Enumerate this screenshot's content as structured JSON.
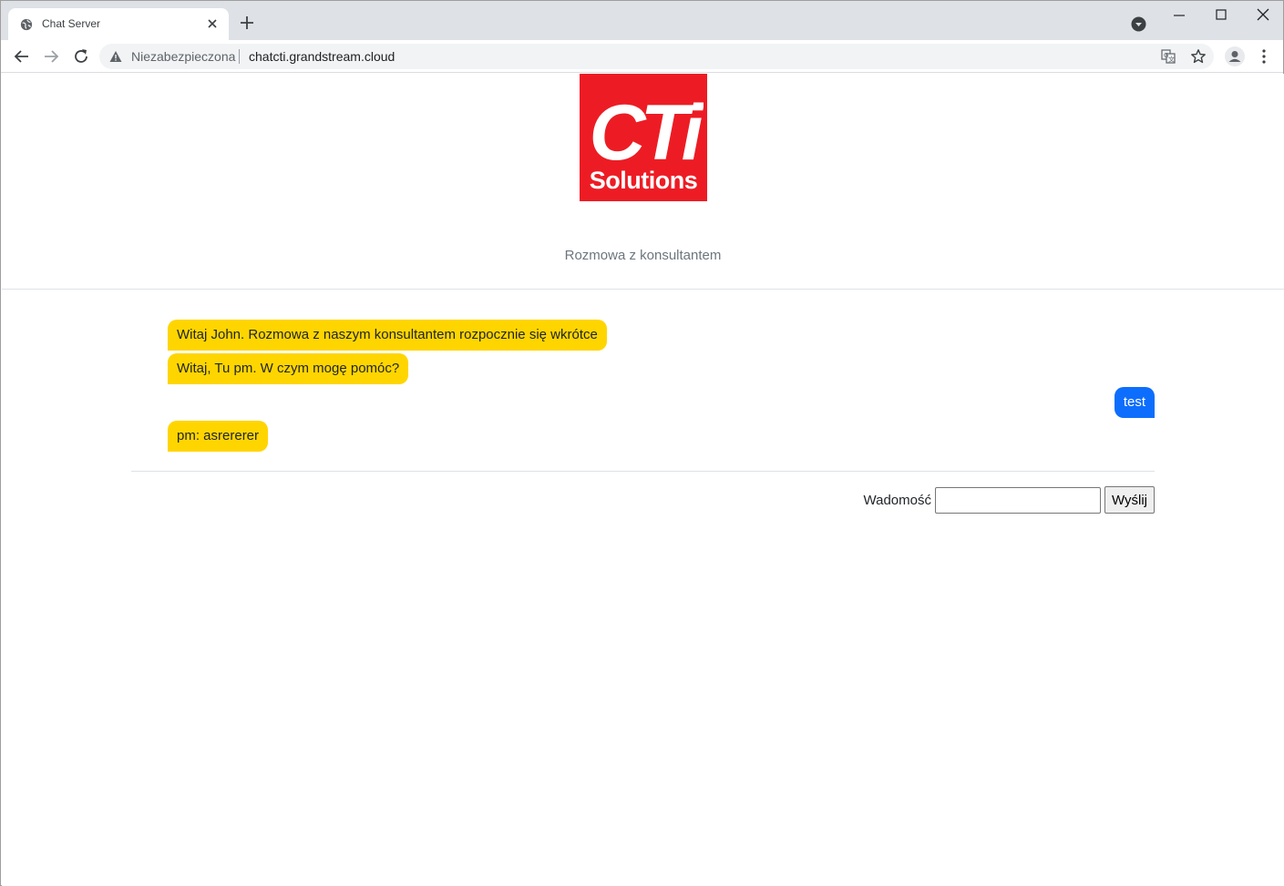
{
  "browser": {
    "tab_title": "Chat Server",
    "security_label": "Niezabezpieczona",
    "url": "chatcti.grandstream.cloud"
  },
  "page": {
    "logo": {
      "line1": "CTi",
      "line2": "Solutions"
    },
    "subtitle": "Rozmowa z konsultantem",
    "messages": [
      {
        "side": "in",
        "text": "Witaj John. Rozmowa z naszym konsultantem rozpocznie się wkrótce"
      },
      {
        "side": "in",
        "text": "Witaj, Tu pm. W czym mogę pomóc?"
      },
      {
        "side": "out",
        "text": "test"
      },
      {
        "side": "in",
        "text": "pm: asrererer"
      }
    ],
    "form": {
      "label": "Wadomość",
      "input_value": "",
      "send_label": "Wyślij"
    }
  },
  "colors": {
    "incoming_bubble": "#ffd500",
    "outgoing_bubble": "#0d6efd",
    "logo_red": "#ed1c24"
  }
}
